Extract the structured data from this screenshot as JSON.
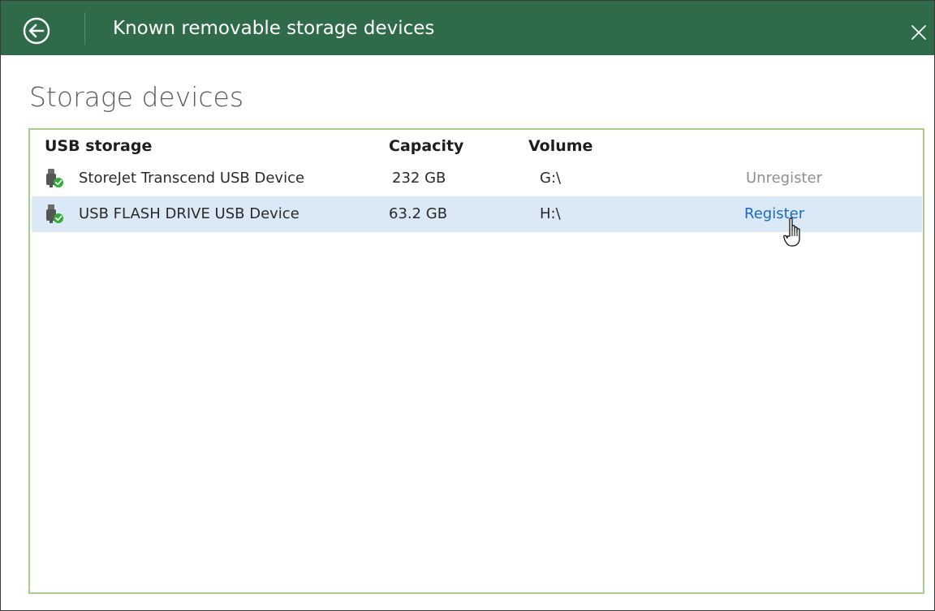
{
  "window": {
    "title": "Known removable storage devices"
  },
  "page": {
    "heading": "Storage devices"
  },
  "table": {
    "columns": {
      "name": "USB storage",
      "capacity": "Capacity",
      "volume": "Volume"
    },
    "rows": [
      {
        "name": "StoreJet Transcend USB Device",
        "capacity": "232 GB",
        "volume": "G:\\",
        "action": "Unregister",
        "selected": false
      },
      {
        "name": "USB FLASH DRIVE USB Device",
        "capacity": "63.2 GB",
        "volume": "H:\\",
        "action": "Register",
        "selected": true
      }
    ]
  },
  "icons": {
    "back": "back-arrow-icon",
    "close": "close-icon",
    "device": "usb-device-icon",
    "status": "check-icon",
    "cursor": "hand-cursor-icon"
  },
  "colors": {
    "titlebar": "#2f6b49",
    "list_border": "#a6ce8a",
    "selection": "#dbe9f7",
    "link": "#1b6ac1",
    "disabled_link": "#8f8f8f",
    "status_green": "#2fae36"
  }
}
